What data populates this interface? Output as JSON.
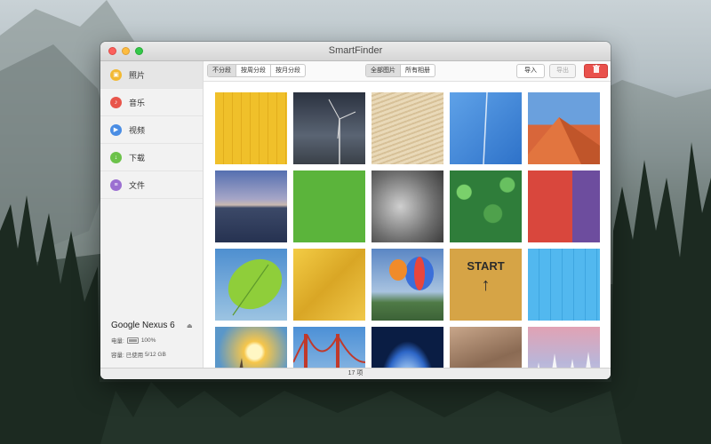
{
  "window": {
    "title": "SmartFinder"
  },
  "sidebar": {
    "items": [
      {
        "label": "照片",
        "icon": "photo-icon",
        "color": "#f2b933"
      },
      {
        "label": "音乐",
        "icon": "music-icon",
        "color": "#e8554b"
      },
      {
        "label": "视频",
        "icon": "video-icon",
        "color": "#4a8de4"
      },
      {
        "label": "下载",
        "icon": "download-icon",
        "color": "#6cc24a"
      },
      {
        "label": "文件",
        "icon": "file-icon",
        "color": "#9b6fd1"
      }
    ],
    "device": {
      "name": "Google Nexus 6",
      "battery_label": "电量:",
      "battery_value": "100%",
      "storage_label": "容量: 已使用",
      "storage_value": "5/12 GB"
    }
  },
  "toolbar": {
    "group_by": [
      "不分段",
      "按周分段",
      "按月分段"
    ],
    "view": [
      "全部图片",
      "所有相册"
    ],
    "import_label": "导入",
    "export_label": "导出"
  },
  "photos": [
    "yellow-planks",
    "wind-turbine",
    "dry-grass",
    "blue-sky-contrail",
    "desert-dune",
    "horizon-sea",
    "green-field",
    "elephant-bw",
    "forest-aerial",
    "red-brick-wall",
    "green-leaf",
    "gold-foil",
    "hot-air-balloons",
    "start-sign-shoes",
    "blue-planks",
    "sunset-tower",
    "golden-gate-bridge",
    "earth-space",
    "sand-dune",
    "snowy-trees"
  ],
  "status": {
    "count": "17 项"
  }
}
